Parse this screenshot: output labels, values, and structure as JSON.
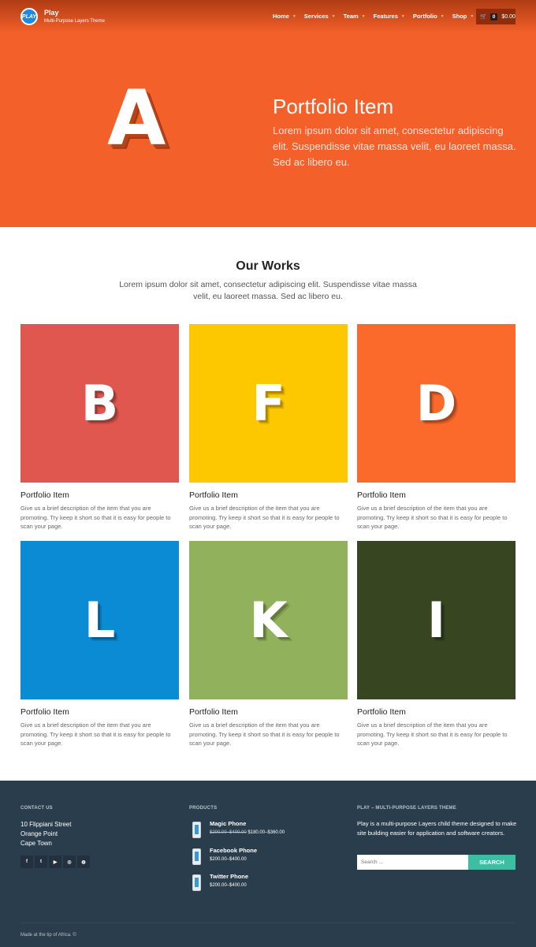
{
  "header": {
    "logo_text": "PLAY",
    "brand_name": "Play",
    "tagline": "Multi-Purpose Layers Theme",
    "nav": [
      {
        "label": "Home"
      },
      {
        "label": "Services"
      },
      {
        "label": "Team"
      },
      {
        "label": "Features"
      },
      {
        "label": "Portfolio"
      },
      {
        "label": "Shop"
      }
    ],
    "cart_count": "0",
    "cart_total": "$0.00"
  },
  "hero": {
    "letter": "A",
    "title": "Portfolio Item",
    "text": "Lorem ipsum dolor sit amet, consectetur adipiscing elit. Suspendisse vitae massa velit, eu laoreet massa. Sed ac libero eu.",
    "bg_color": "#f4602a"
  },
  "works": {
    "title": "Our Works",
    "intro": "Lorem ipsum dolor sit amet, consectetur adipiscing elit. Suspendisse vitae massa velit, eu laoreet massa. Sed ac libero eu.",
    "items": [
      {
        "letter": "B",
        "color": "#e0574f",
        "title": "Portfolio Item",
        "desc": "Give us a brief description of the item that you are promoting. Try keep it short so that it is easy for people to scan your page."
      },
      {
        "letter": "F",
        "color": "#fdc800",
        "title": "Portfolio Item",
        "desc": "Give us a brief description of the item that you are promoting. Try keep it short so that it is easy for people to scan your page."
      },
      {
        "letter": "D",
        "color": "#fb692b",
        "title": "Portfolio Item",
        "desc": "Give us a brief description of the item that you are promoting. Try keep it short so that it is easy for people to scan your page."
      },
      {
        "letter": "L",
        "color": "#0a8bd3",
        "title": "Portfolio Item",
        "desc": "Give us a brief description of the item that you are promoting. Try keep it short so that it is easy for people to scan your page."
      },
      {
        "letter": "K",
        "color": "#91b15c",
        "title": "Portfolio Item",
        "desc": "Give us a brief description of the item that you are promoting. Try keep it short so that it is easy for people to scan your page."
      },
      {
        "letter": "I",
        "color": "#374521",
        "title": "Portfolio Item",
        "desc": "Give us a brief description of the item that you are promoting. Try keep it short so that it is easy for people to scan your page."
      }
    ]
  },
  "footer": {
    "contact_heading": "CONTACT US",
    "address_line1": "10 Flippiani Street",
    "address_line2": "Orange Point",
    "address_line3": "Cape Town",
    "socials": [
      {
        "icon": "facebook-icon",
        "glyph": "f"
      },
      {
        "icon": "twitter-icon",
        "glyph": "t"
      },
      {
        "icon": "youtube-icon",
        "glyph": "▶"
      },
      {
        "icon": "pinterest-icon",
        "glyph": "◎"
      },
      {
        "icon": "dribbble-icon",
        "glyph": "◍"
      }
    ],
    "products_heading": "PRODUCTS",
    "products": [
      {
        "name": "Magic Phone",
        "old_price": "$200.00–$400.00",
        "price": "$180.00–$360.00"
      },
      {
        "name": "Facebook Phone",
        "old_price": "",
        "price": "$200.00–$400.00"
      },
      {
        "name": "Twitter Phone",
        "old_price": "",
        "price": "$200.00–$400.00"
      }
    ],
    "about_heading": "PLAY – MULTI-PURPOSE LAYERS THEME",
    "about_text": "Play is a multi-purpose Layers child theme designed to make site building easier for application and software creators.",
    "search_placeholder": "Search ...",
    "search_button": "SEARCH",
    "copyright": "Made at the tip of Africa. ©"
  }
}
